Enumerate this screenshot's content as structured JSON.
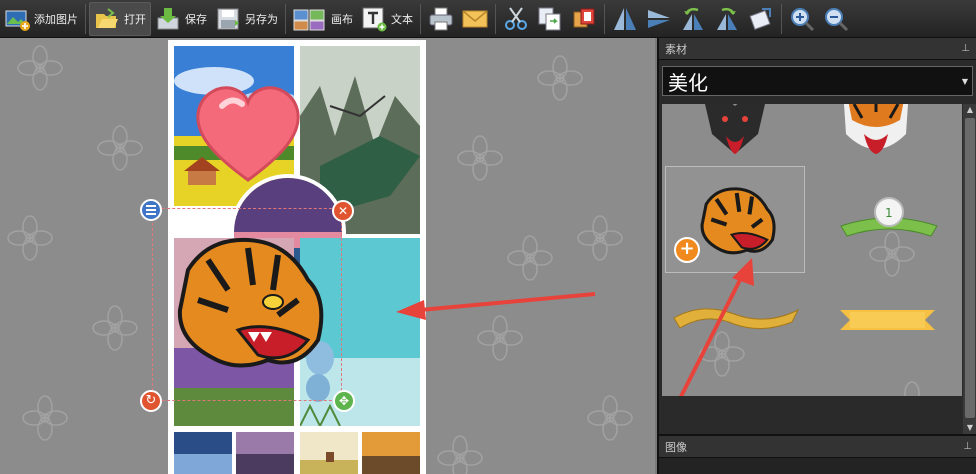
{
  "toolbar": {
    "add_image": "添加图片",
    "open": "打开",
    "save": "保存",
    "save_as": "另存为",
    "canvas": "画布",
    "text": "文本"
  },
  "panel": {
    "materials_title": "素材",
    "category": "美化",
    "image_title": "图像"
  },
  "colors": {
    "annotation_arrow": "#e8433a",
    "handle_blue": "#3f74c6",
    "handle_red": "#e0542f",
    "handle_green": "#5db34c",
    "heart": "#f46a7a"
  }
}
